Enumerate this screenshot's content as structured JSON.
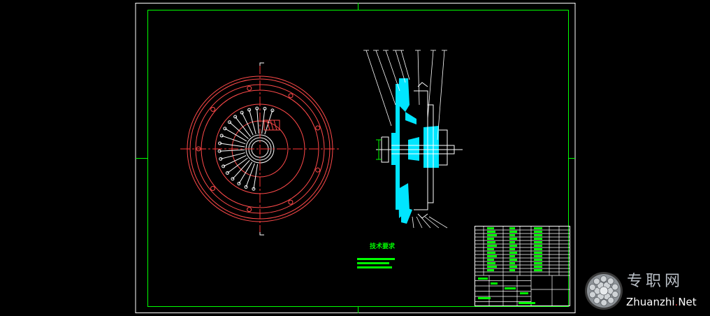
{
  "colors": {
    "background": "#000000",
    "frame": "#ffffff",
    "border": "#00ff00",
    "view_outline": "#ff4a4a",
    "centerline": "#ff3333",
    "section_fill": "#00e5ff",
    "block_text": "#00ff00",
    "watermark_text": "#b9bfc6",
    "watermark_dot": "#e03a3a"
  },
  "drawing": {
    "heading_text": "技术要求",
    "watermark": {
      "logo": "spiky-sphere-logo",
      "name_cn": "专职网",
      "name_en_main": "Zhuanzhi",
      "name_en_dot": ".",
      "name_en_tld": "Net"
    }
  }
}
